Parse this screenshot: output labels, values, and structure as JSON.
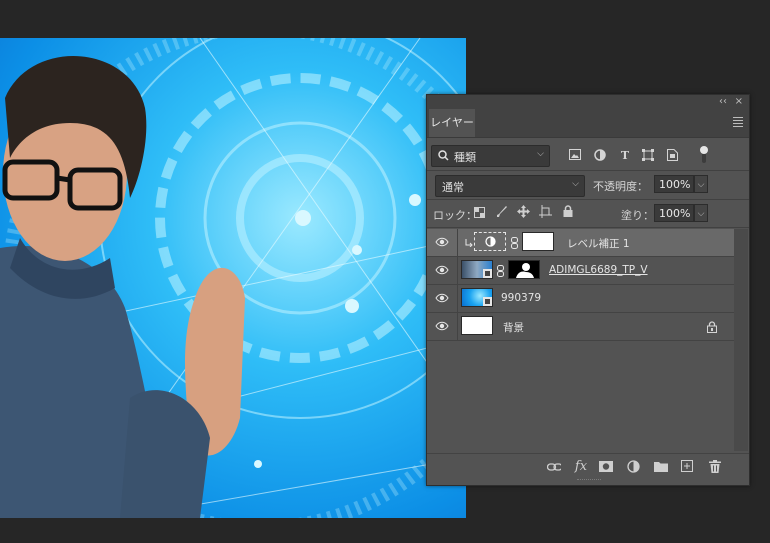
{
  "panel": {
    "collapse_icon": "‹‹",
    "close_icon": "×",
    "tab_label": "レイヤー",
    "filter": {
      "label": "種類",
      "icons": [
        "image-filter-icon",
        "adjustment-filter-icon",
        "type-filter-icon",
        "shape-filter-icon",
        "smart-object-filter-icon"
      ]
    },
    "blend_mode": "通常",
    "opacity_label": "不透明度：",
    "opacity_value": "100%",
    "lock_label": "ロック：",
    "fill_label": "塗り：",
    "fill_value": "100%",
    "layers": [
      {
        "name": "レベル補正 1",
        "type": "adjustment",
        "selected": true
      },
      {
        "name": "ADIMGL6689_TP_V",
        "type": "smart-object-with-mask",
        "selected": false
      },
      {
        "name": "990379",
        "type": "smart-object",
        "selected": false
      },
      {
        "name": "背景",
        "type": "background",
        "selected": false,
        "locked": true
      }
    ],
    "bottom_icons": [
      "link-layers-icon",
      "fx-icon",
      "add-mask-icon",
      "new-adjustment-icon",
      "new-group-icon",
      "new-layer-icon",
      "delete-layer-icon"
    ]
  },
  "colors": {
    "panel_bg": "#535353",
    "selected_layer": "#696969",
    "app_bg": "#262626",
    "canvas_blue": "#1aa3f0"
  }
}
